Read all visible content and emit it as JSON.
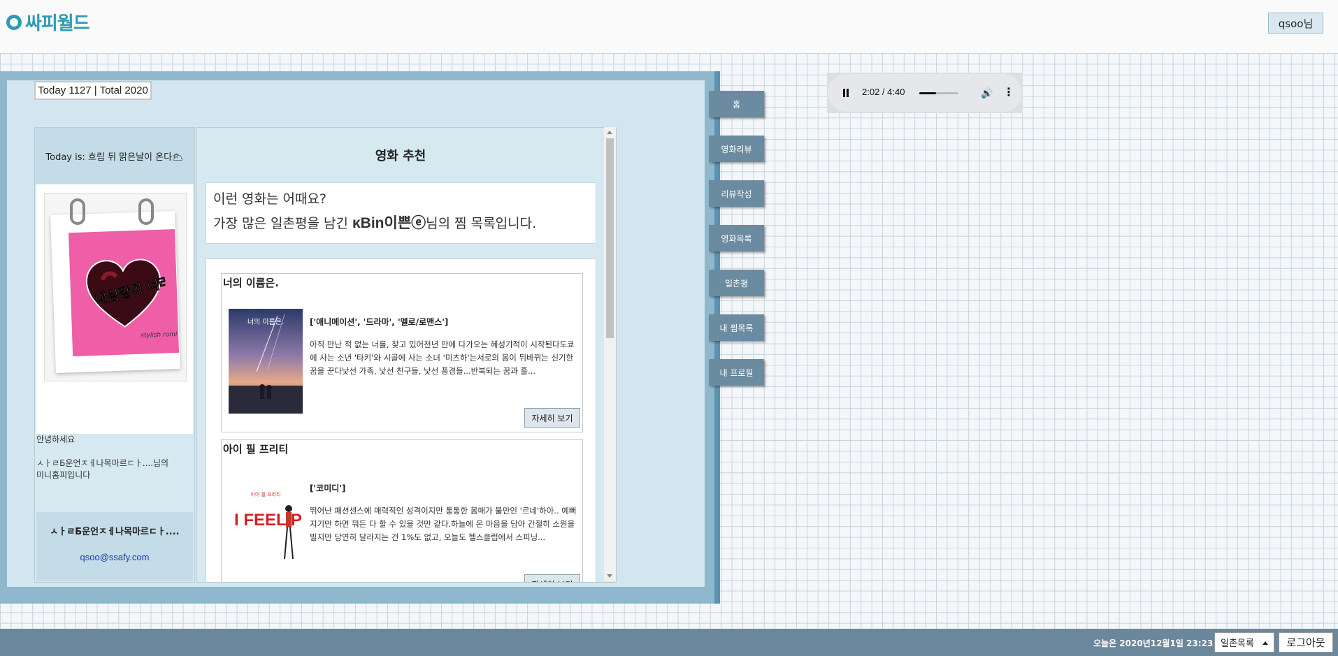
{
  "header": {
    "logo_text": "싸피월드",
    "user_button": "qsoo님"
  },
  "counter": "Today 1127 | Total 2020",
  "left": {
    "today": "Today is: 흐림 뒤 맑은날이 온다🌥",
    "image_caption": "내심장이 너라는데...",
    "image_caption_small": "stylish romi",
    "hello": "안녕하세요",
    "intro": "ㅅㅏㄹБ운언ㅈㅔ나목마르ㄷㅏ....님의 미니홈피입니다",
    "owner_name": "ㅅㅏㄹБ운언ㅈㅔ나목마르ㄷㅏ....",
    "owner_email": "qsoo@ssafy.com"
  },
  "main": {
    "title": "영화 추천",
    "intro_line1": "이런 영화는 어때요?",
    "intro_line2_prefix": "가장 많은 일촌평을 남긴 ",
    "intro_user": "κBin이쁜ⓔ",
    "intro_line2_suffix": "님의 찜 목록입니다.",
    "movies": [
      {
        "title": "너의 이름은.",
        "poster_caption": "너의 이름은.",
        "genres": "['애니메이션', '드라마', '멜로/로맨스']",
        "desc": "아직 만난 적 없는 너를, 찾고 있어천년 만에 다가오는 혜성기적이 시작된다도쿄에 사는 소년 '타키'와 시골에 사는 소녀 '미츠하'는서로의 몸이 뒤바뀌는 신기한 꿈을 꾼다낯선 가족, 낯선 친구들, 낯선 풍경들...반복되는 꿈과 흘...",
        "button": "자세히 보기"
      },
      {
        "title": "아이 필 프리티",
        "poster_caption": "I FEEL PRETTY",
        "genres": "['코미디']",
        "desc": "뛰어난 패션센스에 매력적인 성격이지만 통통한 몸매가 불만인 '르네'하아.. 예뻐지기만 하면 뭐든 다 할 수 있을 것만 같다.하늘에 온 마음을 담아 간절히 소원을 빌지만 당연히 달라지는 건 1%도 없고, 오늘도 헬스클럽에서 스피닝...",
        "button": "자세히 보기"
      }
    ]
  },
  "menu": [
    "홈",
    "영화리뷰",
    "리뷰작성",
    "영화목록",
    "일촌평",
    "내 찜목록",
    "내 프로필"
  ],
  "audio": {
    "time": "2:02 / 4:40",
    "progress": 0.436
  },
  "footer": {
    "date_text": "오늘은 2020년12월1일 23:23",
    "select_value": "일촌목록",
    "logout": "로그아웃"
  }
}
